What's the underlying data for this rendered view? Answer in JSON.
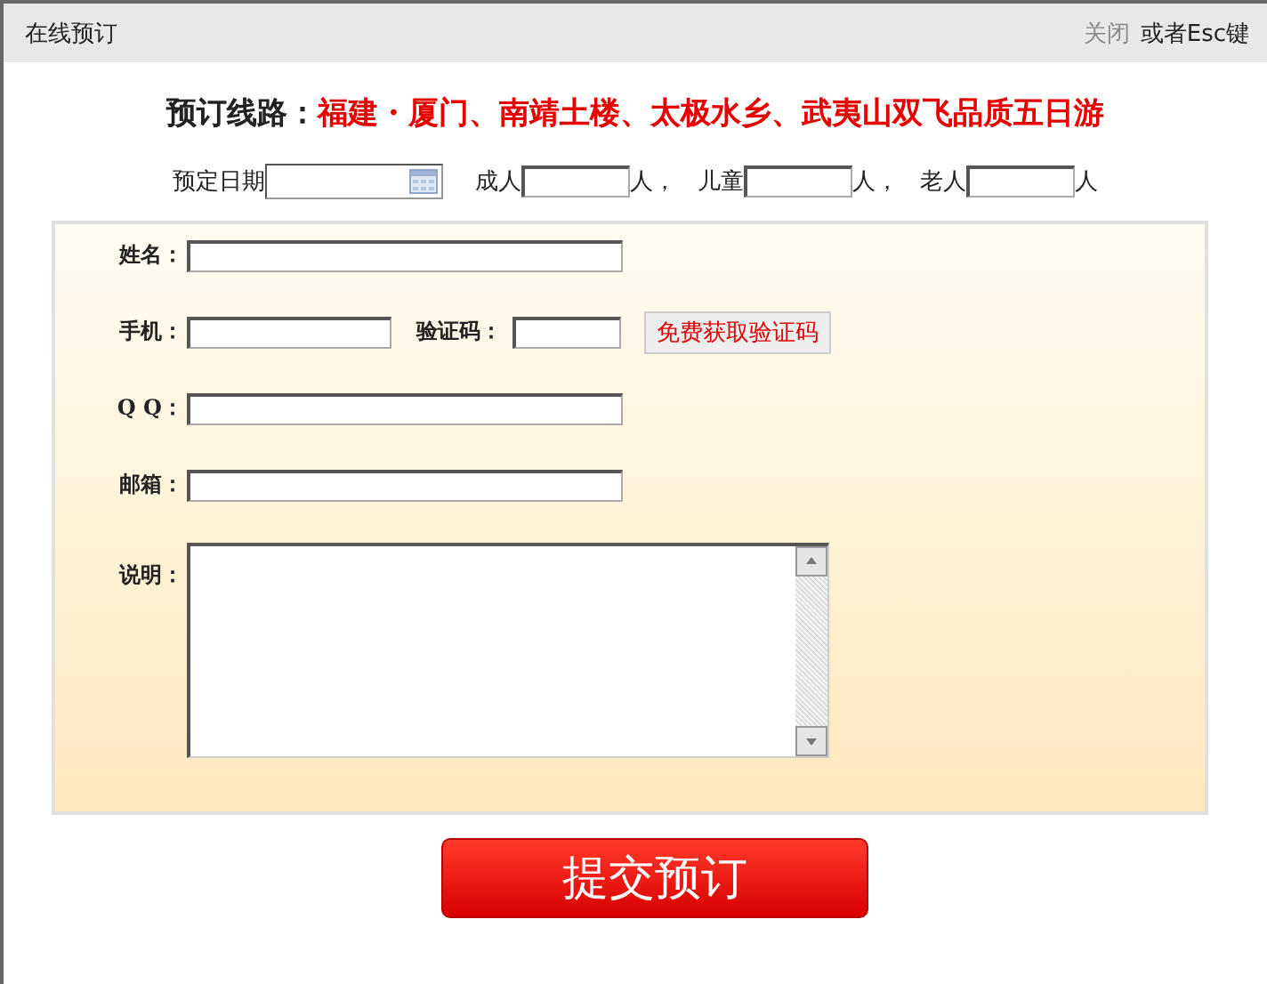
{
  "window": {
    "title": "在线预订",
    "close_link": "关闭",
    "close_hint": "或者Esc键"
  },
  "route": {
    "label": "预订线路：",
    "name": "福建・厦门、南靖土楼、太极水乡、武夷山双飞品质五日游"
  },
  "date_row": {
    "date_label": "预定日期",
    "counts": [
      {
        "label": "成人",
        "unit": "人，"
      },
      {
        "label": "儿童",
        "unit": "人，"
      },
      {
        "label": "老人",
        "unit": "人"
      }
    ]
  },
  "form": [
    {
      "kind": "text",
      "label": "姓名："
    },
    {
      "kind": "code",
      "label": "手机：",
      "code_label": "验证码：",
      "code_button": "免费获取验证码"
    },
    {
      "kind": "text",
      "label": "Q Q："
    },
    {
      "kind": "text",
      "label": "邮箱："
    },
    {
      "kind": "textarea",
      "label": "说明："
    }
  ],
  "submit": "提交预订"
}
